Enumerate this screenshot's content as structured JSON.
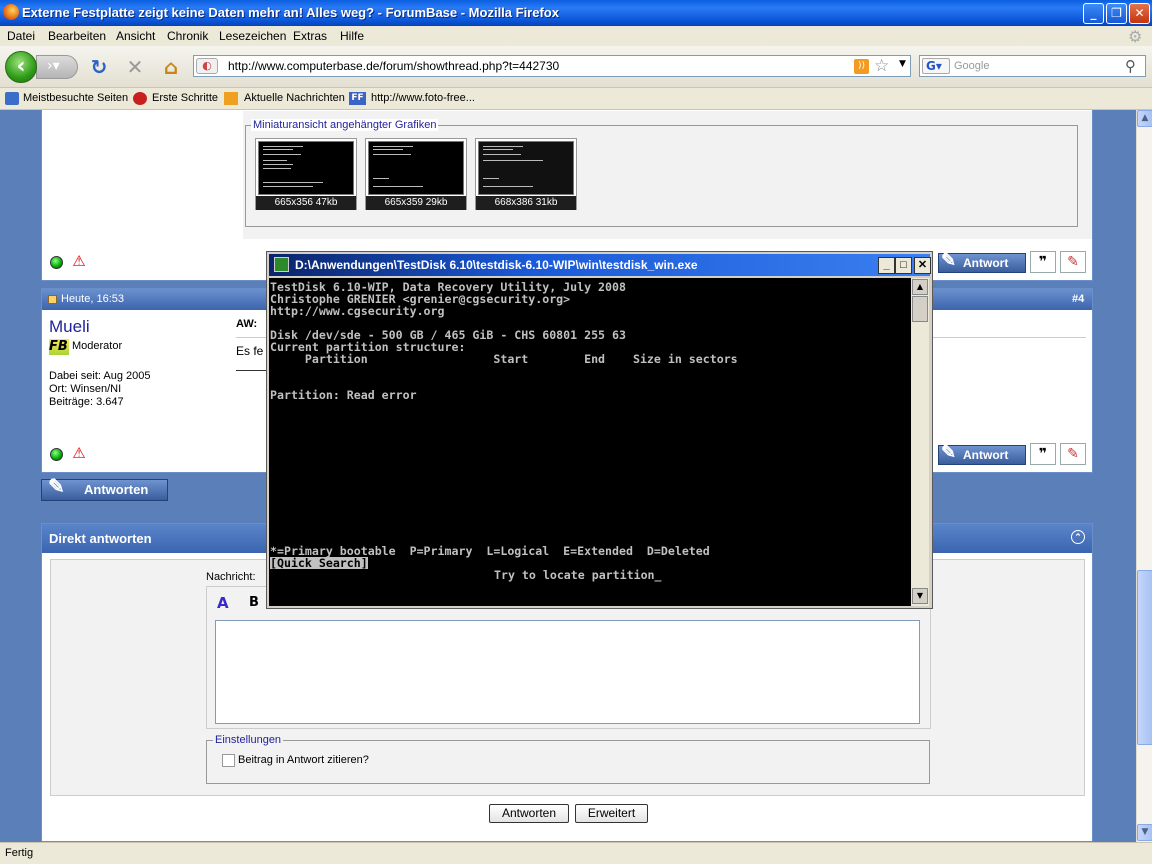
{
  "window": {
    "title": "Externe Festplatte zeigt keine Daten mehr an! Alles weg? - ForumBase - Mozilla Firefox"
  },
  "menu": [
    "Datei",
    "Bearbeiten",
    "Ansicht",
    "Chronik",
    "Lesezeichen",
    "Extras",
    "Hilfe"
  ],
  "nav": {
    "url": "http://www.computerbase.de/forum/showthread.php?t=442730",
    "search_placeholder": "Google"
  },
  "bookmarks": [
    "Meistbesuchte Seiten",
    "Erste Schritte",
    "Aktuelle Nachrichten",
    "http://www.foto-free..."
  ],
  "attachments": {
    "legend": "Miniaturansicht angehängter Grafiken",
    "items": [
      {
        "caption": "665x356 47kb"
      },
      {
        "caption": "665x359 29kb"
      },
      {
        "caption": "668x386 31kb"
      }
    ]
  },
  "post4": {
    "date": "Heute, 16:53",
    "number": "#4",
    "username": "Mueli",
    "role": "Moderator",
    "joined": "Dabei seit: Aug 2005",
    "location": "Ort: Winsen/NI",
    "posts": "Beiträge: 3.647",
    "title_fragment": "AW:",
    "text_fragment": "Es fe"
  },
  "buttons": {
    "reply": "Antwort",
    "reply_main": "Antworten"
  },
  "quick_reply": {
    "title": "Direkt antworten",
    "message_label": "Nachricht:",
    "settings_legend": "Einstellungen",
    "quote_checkbox": "Beitrag in Antwort zitieren?",
    "submit": "Antworten",
    "advanced": "Erweitert"
  },
  "console": {
    "title": "D:\\Anwendungen\\TestDisk 6.10\\testdisk-6.10-WIP\\win\\testdisk_win.exe",
    "lines": [
      "TestDisk 6.10-WIP, Data Recovery Utility, July 2008",
      "Christophe GRENIER <grenier@cgsecurity.org>",
      "http://www.cgsecurity.org",
      "",
      "Disk /dev/sde - 500 GB / 465 GiB - CHS 60801 255 63",
      "Current partition structure:",
      "     Partition                  Start        End    Size in sectors",
      "",
      "",
      "Partition: Read error"
    ],
    "legend_line": "*=Primary bootable  P=Primary  L=Logical  E=Extended  D=Deleted",
    "quick_search": "[Quick Search]",
    "prompt": "Try to locate partition"
  },
  "status": "Fertig"
}
